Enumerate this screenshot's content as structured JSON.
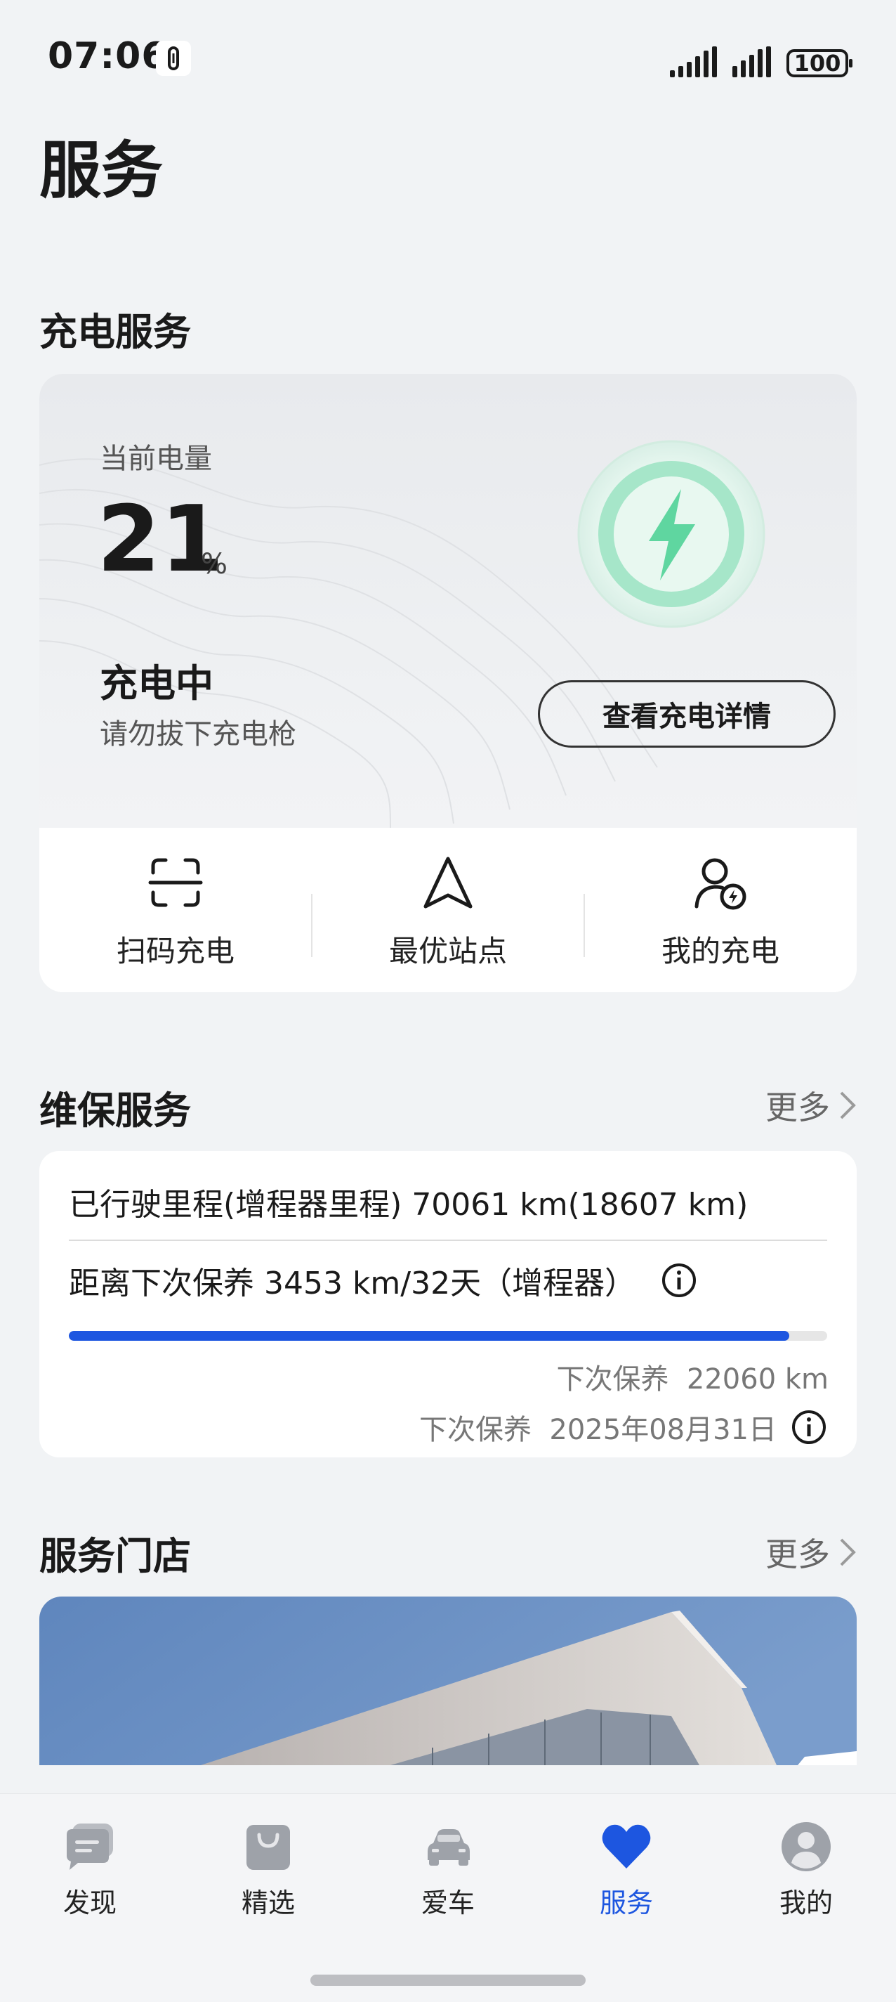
{
  "status_bar": {
    "time": "07:06",
    "battery": "100"
  },
  "page": {
    "title": "服务"
  },
  "charging": {
    "section_title": "充电服务",
    "battery_label": "当前电量",
    "battery_value": "21",
    "battery_unit": "%",
    "status": "充电中",
    "tip": "请勿拔下充电枪",
    "detail_button": "查看充电详情",
    "quick_actions": [
      {
        "label": "扫码充电",
        "icon": "scan-icon"
      },
      {
        "label": "最优站点",
        "icon": "navigation-icon"
      },
      {
        "label": "我的充电",
        "icon": "user-charge-icon"
      }
    ],
    "accent_color": "#5fd6a0"
  },
  "maintenance": {
    "section_title": "维保服务",
    "more": "更多",
    "mileage": "已行驶里程(增程器里程) 70061 km(18607 km)",
    "next_distance": "距离下次保养 3453 km/32天（增程器）",
    "progress": 0.95,
    "next_mileage_label": "下次保养",
    "next_mileage_value": "22060 km",
    "next_date_label": "下次保养",
    "next_date_value": "2025年08月31日",
    "progress_color": "#1d56e0"
  },
  "stores": {
    "section_title": "服务门店",
    "more": "更多"
  },
  "bottom_nav": {
    "items": [
      {
        "label": "发现",
        "icon": "chat-icon"
      },
      {
        "label": "精选",
        "icon": "shopping-bag-icon"
      },
      {
        "label": "爱车",
        "icon": "car-icon"
      },
      {
        "label": "服务",
        "icon": "heart-icon"
      },
      {
        "label": "我的",
        "icon": "profile-icon"
      }
    ],
    "active": "服务",
    "active_color": "#1d56e0"
  }
}
